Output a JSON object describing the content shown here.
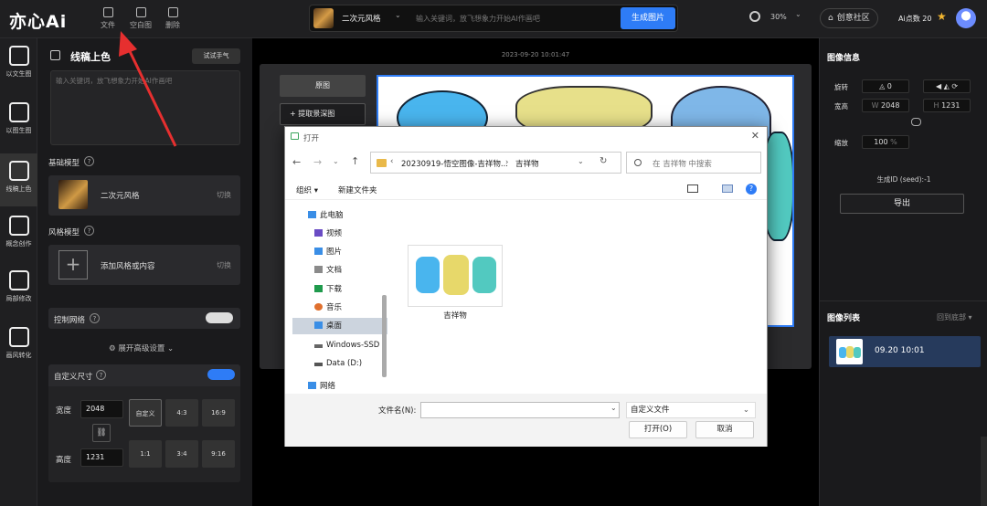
{
  "header": {
    "logo": "亦心Ai",
    "tools": [
      {
        "label": "文件",
        "icon": "file-icon"
      },
      {
        "label": "空白图",
        "icon": "blank-image-icon"
      },
      {
        "label": "删除",
        "icon": "trash-icon"
      }
    ],
    "style_name": "二次元风格",
    "prompt_placeholder": "输入关键词，放飞想象力开始AI作画吧",
    "generate_label": "生成图片",
    "zoom": "30%",
    "community_label": "创意社区",
    "points_label": "Ai点数 20"
  },
  "leftnav": [
    {
      "label": "以文生图",
      "icon": "text-to-image-icon"
    },
    {
      "label": "以图生图",
      "icon": "image-to-image-icon"
    },
    {
      "label": "线稿上色",
      "icon": "line-coloring-icon"
    },
    {
      "label": "概念创作",
      "icon": "concept-icon"
    },
    {
      "label": "局部修改",
      "icon": "local-edit-icon"
    },
    {
      "label": "画风转化",
      "icon": "style-transfer-icon"
    }
  ],
  "panel": {
    "title": "线稿上色",
    "try_label": "试试手气",
    "prompt_placeholder": "输入关键词，放飞想象力开始AI作画吧",
    "base_model_label": "基础模型",
    "base_model_name": "二次元风格",
    "switch_label": "切换",
    "style_model_label": "风格模型",
    "add_style_label": "添加风格或内容",
    "control_net_label": "控制网络",
    "advanced_label": "展开高级设置",
    "custom_size_label": "自定义尺寸",
    "width_label": "宽度",
    "width_value": "2048",
    "height_label": "高度",
    "height_value": "1231",
    "ratios": [
      "自定义",
      "4:3",
      "16:9",
      "1:1",
      "3:4",
      "9:16"
    ]
  },
  "canvas": {
    "timestamp": "2023-09-20 10:01:47",
    "original_label": "原图",
    "extract_label": "提取景深图"
  },
  "right": {
    "info_title": "图像信息",
    "rotate_label": "旋转",
    "rotate_value": "0",
    "size_label": "宽高",
    "w_prefix": "W",
    "w_value": "2048",
    "h_prefix": "H",
    "h_value": "1231",
    "scale_label": "缩放",
    "scale_value": "100",
    "scale_unit": "%",
    "seed_label": "生成ID (seed):-1",
    "export_label": "导出",
    "list_title": "图像列表",
    "back_bottom_label": "回到底部",
    "item_time": "09.20 10:01"
  },
  "dialog": {
    "title": "打开",
    "path_part1": "20230919-悟空图像-吉祥物...",
    "path_part2": "吉祥物",
    "search_placeholder": "在 吉祥物 中搜索",
    "organize_label": "组织",
    "new_folder_label": "新建文件夹",
    "tree": [
      {
        "label": "此电脑",
        "icon": "computer-icon",
        "color": "#3a8ee6"
      },
      {
        "label": "视频",
        "icon": "video-folder-icon",
        "color": "#6a4cc4"
      },
      {
        "label": "图片",
        "icon": "picture-folder-icon",
        "color": "#3a8ee6"
      },
      {
        "label": "文档",
        "icon": "document-folder-icon",
        "color": "#8a8a8a"
      },
      {
        "label": "下载",
        "icon": "download-folder-icon",
        "color": "#1f9a4c"
      },
      {
        "label": "音乐",
        "icon": "music-folder-icon",
        "color": "#e0702e"
      },
      {
        "label": "桌面",
        "icon": "desktop-folder-icon",
        "color": "#3a8ee6"
      },
      {
        "label": "Windows-SSD",
        "icon": "drive-icon",
        "color": "#666666"
      },
      {
        "label": "Data (D:)",
        "icon": "drive-icon",
        "color": "#555555"
      },
      {
        "label": "网络",
        "icon": "network-icon",
        "color": "#3a8ee6"
      }
    ],
    "file_name": "吉祥物",
    "filename_label": "文件名(N):",
    "filetype_label": "自定义文件",
    "open_label": "打开(O)",
    "cancel_label": "取消"
  }
}
